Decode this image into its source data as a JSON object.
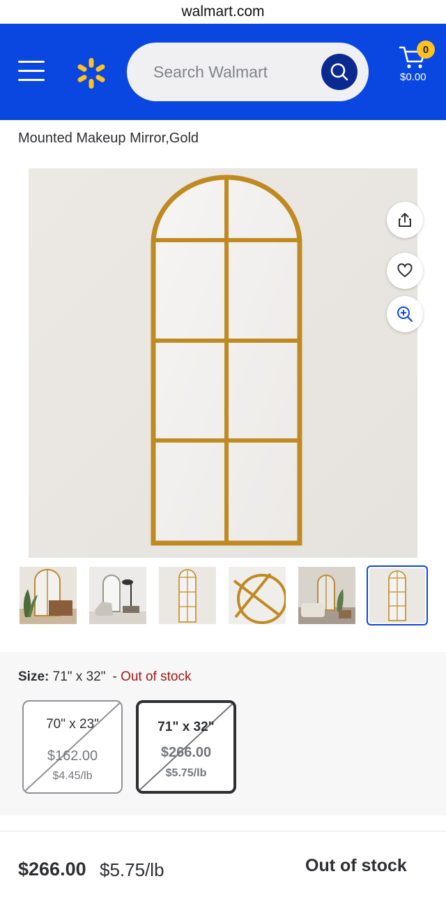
{
  "browser": {
    "url": "walmart.com"
  },
  "header": {
    "search_placeholder": "Search Walmart",
    "cart_count": "0",
    "cart_total": "$0.00",
    "colors": {
      "brand_blue": "#0a46e0",
      "spark_yellow": "#ffc220",
      "search_button": "#0a2a8f"
    }
  },
  "product": {
    "title": "Mounted Makeup Mirror,Gold"
  },
  "image_actions": [
    "share-icon",
    "heart-icon",
    "zoom-in-icon"
  ],
  "thumbnails": [
    "room-scene-plant",
    "room-scene-lamp",
    "mirror-front",
    "frame-detail",
    "room-scene-sofa",
    "mirror-front-selected"
  ],
  "size": {
    "label": "Size:",
    "selected": "71\" x 32\"",
    "separator": "-",
    "status": "Out of stock",
    "options": [
      {
        "dimensions": "70\" x 23\"",
        "price": "$162.00",
        "unit_price": "$4.45/lb"
      },
      {
        "dimensions": "71\" x 32\"",
        "price": "$266.00",
        "unit_price": "$5.75/lb"
      }
    ]
  },
  "footer": {
    "price": "$266.00",
    "unit_price": "$5.75/lb",
    "status": "Out of stock"
  }
}
